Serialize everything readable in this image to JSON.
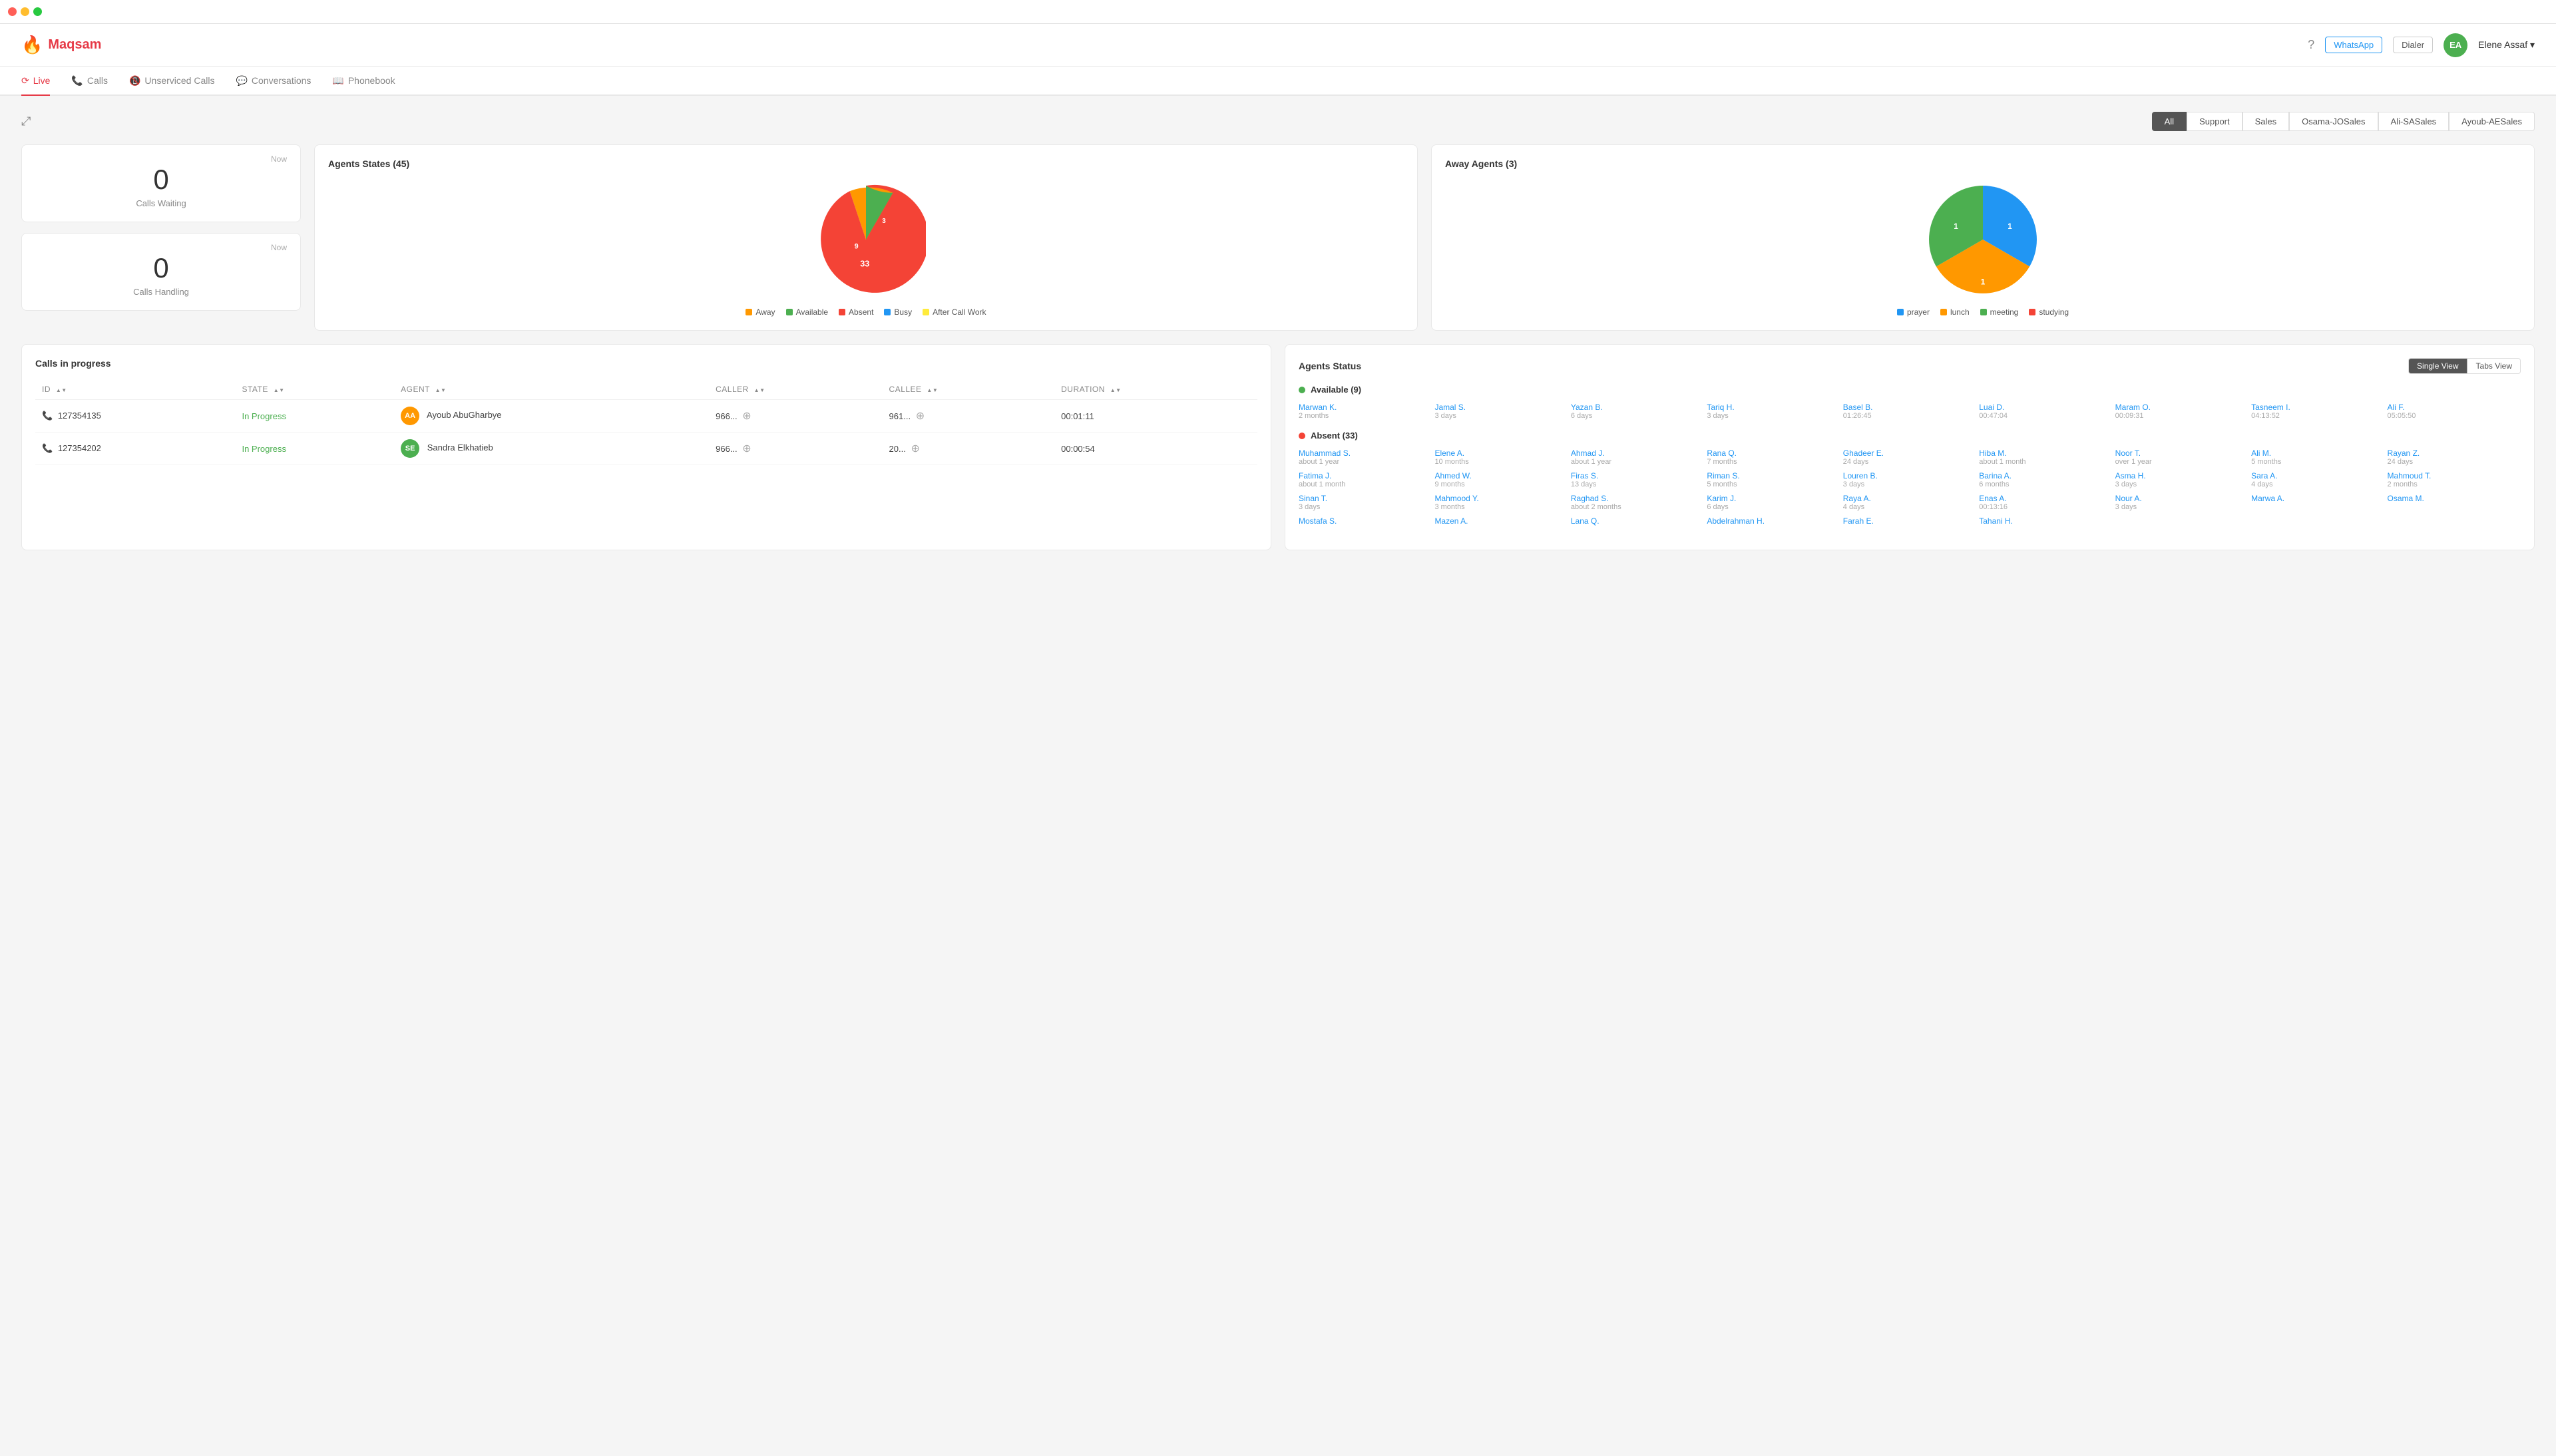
{
  "app": {
    "title": "Maqsam",
    "logo_text": "Maqsam"
  },
  "title_bar": {
    "lights": [
      "red",
      "yellow",
      "green"
    ]
  },
  "header": {
    "whatsapp_label": "WhatsApp",
    "dialer_label": "Dialer",
    "help_icon": "help-circle",
    "avatar_initials": "EA",
    "user_name": "Elene Assaf"
  },
  "nav": {
    "tabs": [
      {
        "id": "live",
        "label": "Live",
        "icon": "live",
        "active": true
      },
      {
        "id": "calls",
        "label": "Calls",
        "icon": "phone",
        "active": false
      },
      {
        "id": "unserviced",
        "label": "Unserviced Calls",
        "icon": "phone-missed",
        "active": false
      },
      {
        "id": "conversations",
        "label": "Conversations",
        "icon": "chat",
        "active": false
      },
      {
        "id": "phonebook",
        "label": "Phonebook",
        "icon": "book",
        "active": false
      }
    ]
  },
  "filters": {
    "buttons": [
      {
        "label": "All",
        "active": true
      },
      {
        "label": "Support",
        "active": false
      },
      {
        "label": "Sales",
        "active": false
      },
      {
        "label": "Osama-JOSales",
        "active": false
      },
      {
        "label": "Ali-SASales",
        "active": false
      },
      {
        "label": "Ayoub-AESales",
        "active": false
      }
    ]
  },
  "calls_waiting": {
    "label": "Now",
    "count": "0",
    "description": "Calls Waiting"
  },
  "calls_handling": {
    "label": "Now",
    "count": "0",
    "description": "Calls Handling"
  },
  "agents_states": {
    "title": "Agents States (45)",
    "pie_data": [
      {
        "label": "Away",
        "value": 9,
        "color": "#FF9800",
        "percent": 20
      },
      {
        "label": "Available",
        "value": 3,
        "color": "#4CAF50",
        "percent": 7
      },
      {
        "label": "Absent",
        "value": 33,
        "color": "#f44336",
        "percent": 73
      },
      {
        "label": "Busy",
        "value": 0,
        "color": "#2196F3",
        "percent": 0
      },
      {
        "label": "After Call Work",
        "value": 0,
        "color": "#FFEB3B",
        "percent": 0
      }
    ],
    "labels": [
      {
        "text": "9",
        "x": "100",
        "y": "140"
      },
      {
        "text": "3",
        "x": "148",
        "y": "88"
      },
      {
        "text": "33",
        "x": "175",
        "y": "155"
      }
    ]
  },
  "away_agents": {
    "title": "Away Agents (3)",
    "pie_data": [
      {
        "label": "prayer",
        "value": 1,
        "color": "#2196F3",
        "percent": 33
      },
      {
        "label": "lunch",
        "value": 1,
        "color": "#FF9800",
        "percent": 34
      },
      {
        "label": "meeting",
        "value": 1,
        "color": "#4CAF50",
        "percent": 33
      },
      {
        "label": "studying",
        "value": 0,
        "color": "#f44336",
        "percent": 0
      }
    ],
    "labels": [
      {
        "text": "1",
        "x": "105",
        "y": "95"
      },
      {
        "text": "1",
        "x": "160",
        "y": "105"
      },
      {
        "text": "1",
        "x": "120",
        "y": "155"
      }
    ]
  },
  "calls_in_progress": {
    "title": "Calls in progress",
    "columns": [
      {
        "label": "ID"
      },
      {
        "label": "STATE"
      },
      {
        "label": "AGENT"
      },
      {
        "label": "CALLER"
      },
      {
        "label": "CALLEE"
      },
      {
        "label": "DURATION"
      }
    ],
    "rows": [
      {
        "id": "127354135",
        "state": "In Progress",
        "agent_initials": "AA",
        "agent_name": "Ayoub AbuGharbye",
        "agent_badge_class": "badge-aa",
        "caller": "966...",
        "callee": "961...",
        "duration": "00:01:11"
      },
      {
        "id": "127354202",
        "state": "In Progress",
        "agent_initials": "SE",
        "agent_name": "Sandra Elkhatieb",
        "agent_badge_class": "badge-se",
        "caller": "966...",
        "callee": "20...",
        "duration": "00:00:54"
      }
    ]
  },
  "agents_status": {
    "title": "Agents Status",
    "view_buttons": [
      {
        "label": "Single View",
        "active": true
      },
      {
        "label": "Tabs View",
        "active": false
      }
    ],
    "sections": [
      {
        "label": "Available (9)",
        "dot_class": "dot-green",
        "agents": [
          {
            "name": "Marwan K.",
            "time": "2 months"
          },
          {
            "name": "Jamal S.",
            "time": "3 days"
          },
          {
            "name": "Yazan B.",
            "time": "6 days"
          },
          {
            "name": "Tariq H.",
            "time": "3 days"
          },
          {
            "name": "Basel B.",
            "time": "01:26:45"
          },
          {
            "name": "Luai D.",
            "time": "00:47:04"
          },
          {
            "name": "Maram O.",
            "time": "00:09:31"
          },
          {
            "name": "Tasneem I.",
            "time": "04:13:52"
          },
          {
            "name": "Ali F.",
            "time": "05:05:50"
          }
        ]
      },
      {
        "label": "Absent (33)",
        "dot_class": "dot-red",
        "agents": [
          {
            "name": "Muhammad S.",
            "time": "about 1 year"
          },
          {
            "name": "Elene A.",
            "time": "10 months"
          },
          {
            "name": "Ahmad J.",
            "time": "about 1 year"
          },
          {
            "name": "Rana Q.",
            "time": "7 months"
          },
          {
            "name": "Ghadeer E.",
            "time": "24 days"
          },
          {
            "name": "Hiba M.",
            "time": "about 1 month"
          },
          {
            "name": "Noor T.",
            "time": "over 1 year"
          },
          {
            "name": "Ali M.",
            "time": "5 months"
          },
          {
            "name": "Rayan Z.",
            "time": "24 days"
          },
          {
            "name": "Fatima J.",
            "time": "about 1 month"
          },
          {
            "name": "Ahmed W.",
            "time": "9 months"
          },
          {
            "name": "Firas S.",
            "time": "13 days"
          },
          {
            "name": "Riman S.",
            "time": "5 months"
          },
          {
            "name": "Louren B.",
            "time": "3 days"
          },
          {
            "name": "Barina A.",
            "time": "6 months"
          },
          {
            "name": "Asma H.",
            "time": "3 days"
          },
          {
            "name": "Sara A.",
            "time": "4 days"
          },
          {
            "name": "Mahmoud T.",
            "time": "2 months"
          },
          {
            "name": "Sinan T.",
            "time": "3 days"
          },
          {
            "name": "Mahmood Y.",
            "time": "3 months"
          },
          {
            "name": "Raghad S.",
            "time": "about 2 months"
          },
          {
            "name": "Karim J.",
            "time": "6 days"
          },
          {
            "name": "Raya A.",
            "time": "4 days"
          },
          {
            "name": "Enas A.",
            "time": "00:13:16"
          },
          {
            "name": "Nour A.",
            "time": "3 days"
          },
          {
            "name": "Marwa A.",
            "time": ""
          },
          {
            "name": "Osama M.",
            "time": ""
          },
          {
            "name": "Mostafa S.",
            "time": ""
          },
          {
            "name": "Mazen A.",
            "time": ""
          },
          {
            "name": "Lana Q.",
            "time": ""
          },
          {
            "name": "Abdelrahman H.",
            "time": ""
          },
          {
            "name": "Farah E.",
            "time": ""
          },
          {
            "name": "Tahani H.",
            "time": ""
          }
        ]
      }
    ]
  }
}
